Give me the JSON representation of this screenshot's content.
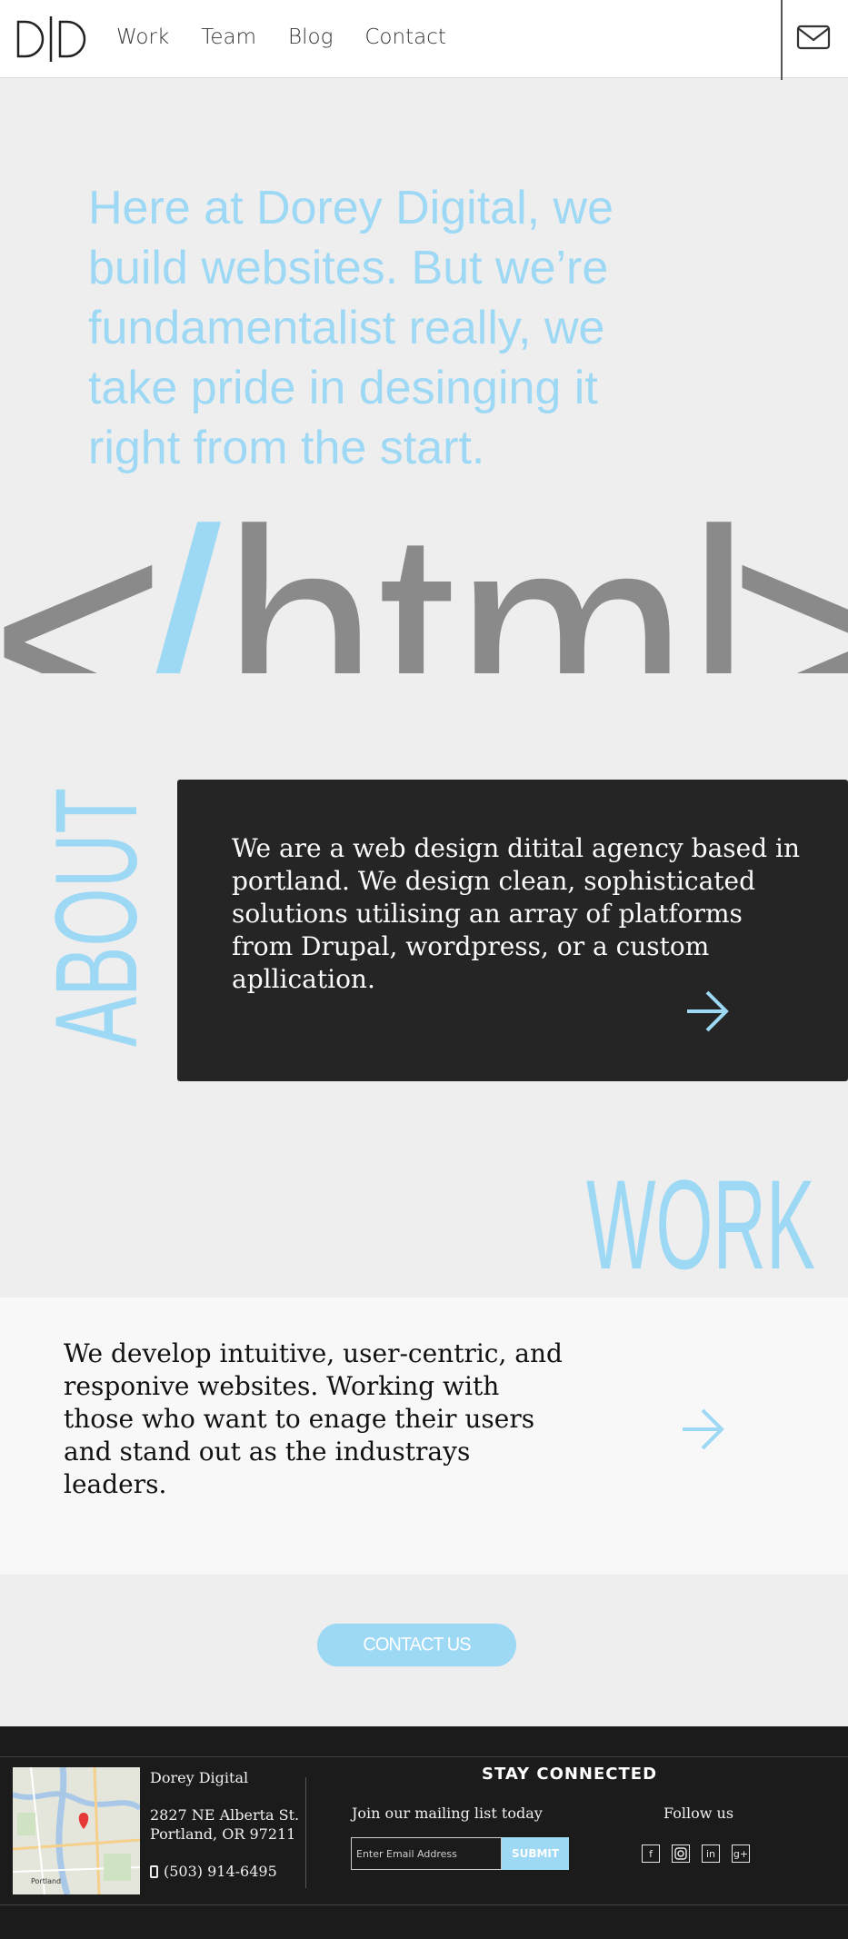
{
  "nav": {
    "logo_icon": "dorey-digital-logo",
    "links": [
      "Work",
      "Team",
      "Blog",
      "Contact"
    ],
    "mail_icon": "envelope-icon"
  },
  "hero": {
    "tagline": "Here at Dorey Digital, we build websites. But we’re fundamentalist really, we take pride in desinging it right from the start.",
    "big_open": "<",
    "big_slash": "/",
    "big_word": "html",
    "big_close": ">"
  },
  "about": {
    "heading": "ABOUT",
    "body": "We are a web design ditital agency based in portland. We design clean, sophisticated solutions utilising an array of platforms from Drupal, wordpress, or a custom apllication.",
    "arrow_icon": "arrow-right-icon"
  },
  "work": {
    "heading": "WORK",
    "body": " We develop intuitive, user-centric, and responive websites. Working with those who want to enage their users and stand out as the industrays leaders.",
    "arrow_icon": "arrow-right-icon"
  },
  "contact_button": "CONTACT US",
  "footer": {
    "company": "Dorey Digital",
    "address_line1": "2827 NE Alberta St.",
    "address_line2": "Portland, OR 97211",
    "phone": "(503) 914-6495",
    "map_label": "Portland",
    "stay_connected": "STAY CONNECTED",
    "mailing_label": "Join our mailing list today",
    "email_placeholder": "Enter Email Address",
    "submit": "SUBMIT",
    "follow": "Follow us",
    "socials": [
      "facebook-icon",
      "instagram-icon",
      "linkedin-icon",
      "google-plus-icon"
    ]
  },
  "colors": {
    "accent": "#9dd8f5",
    "dark": "#252525",
    "footer": "#1b1b1b",
    "hero_gray": "#8a8a8a"
  }
}
